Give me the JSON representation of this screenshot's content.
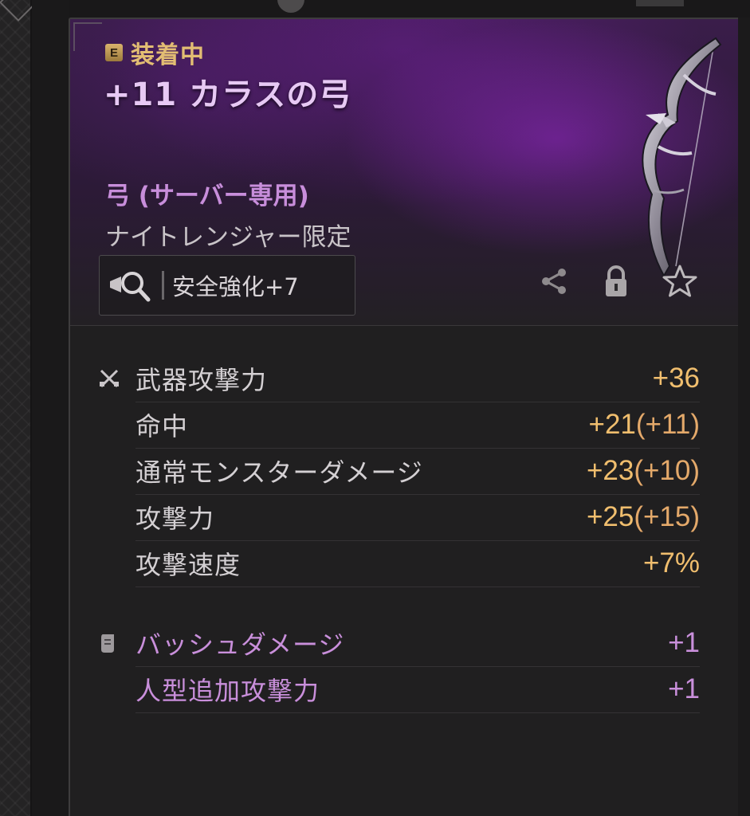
{
  "tooltip": {
    "equip_badge": "E",
    "equip_status": "装着中",
    "item_name": "+11 カラスの弓",
    "item_type": "弓 (サーバー専用)",
    "class_limit": "ナイトレンジャー限定",
    "safe_enhance_label": "安全強化+7",
    "icons": [
      "magnify-icon",
      "share-icon",
      "lock-icon",
      "star-icon"
    ]
  },
  "stats": [
    {
      "label": "武器攻撃力",
      "value": "+36",
      "bonus": ""
    },
    {
      "label": "命中",
      "value": "+21",
      "bonus": "(+11)"
    },
    {
      "label": "通常モンスターダメージ",
      "value": "+23",
      "bonus": "(+10)"
    },
    {
      "label": "攻撃力",
      "value": "+25",
      "bonus": "(+15)"
    },
    {
      "label": "攻撃速度",
      "value": "+7%",
      "bonus": ""
    }
  ],
  "special_stats": [
    {
      "label": "バッシュダメージ",
      "value": "+1"
    },
    {
      "label": "人型追加攻撃力",
      "value": "+1"
    }
  ],
  "colors": {
    "equip_gold": "#e2bd73",
    "name_pink": "#e7c9f4",
    "type_purple": "#c88edb",
    "value_gold": "#f0be6e",
    "special_purple": "#c98fdb"
  }
}
